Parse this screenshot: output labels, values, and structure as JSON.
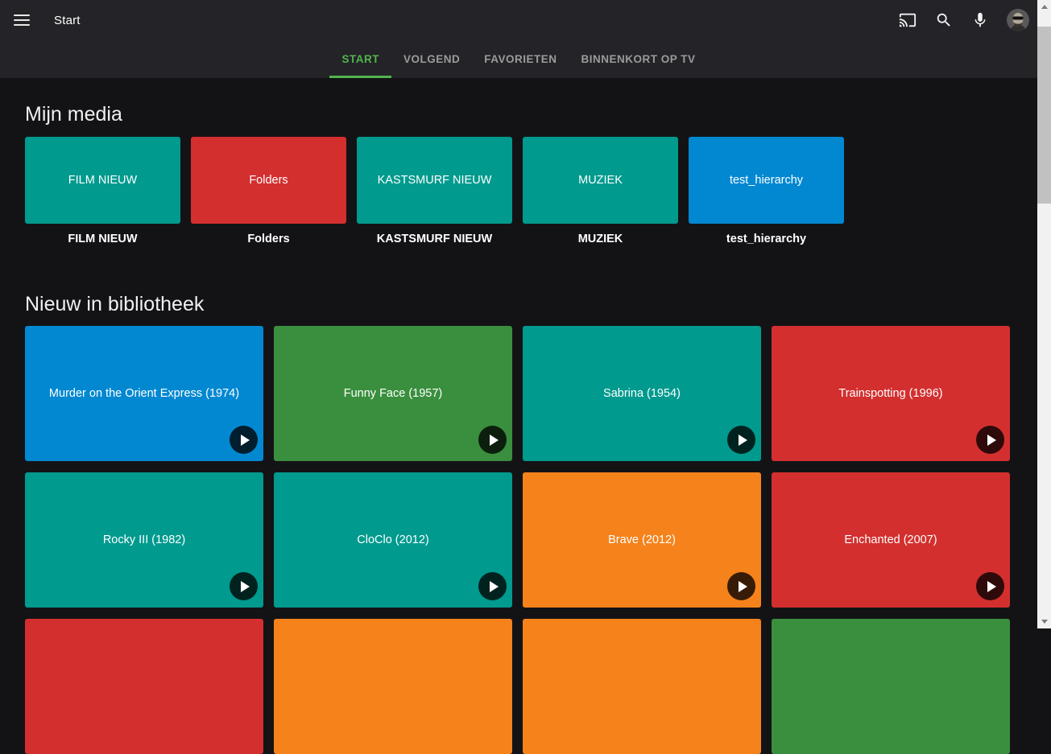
{
  "header": {
    "title": "Start",
    "icons": [
      "menu-icon",
      "cast-icon",
      "search-icon",
      "voice-search-icon",
      "user-avatar"
    ],
    "tabs": [
      {
        "label": "START",
        "active": true
      },
      {
        "label": "VOLGEND",
        "active": false
      },
      {
        "label": "FAVORIETEN",
        "active": false
      },
      {
        "label": "BINNENKORT OP TV",
        "active": false
      }
    ]
  },
  "colors": {
    "accent_green": "#52b54b",
    "header_bg": "#232328",
    "page_bg": "#131316",
    "teal": "#009a8e",
    "red": "#d32f2f",
    "blue": "#0288d1",
    "green": "#3a8f3e",
    "orange": "#f5821b"
  },
  "my_media": {
    "title": "Mijn media",
    "items": [
      {
        "label": "FILM NIEUW",
        "color": "#009a8e"
      },
      {
        "label": "Folders",
        "color": "#d32f2f"
      },
      {
        "label": "KASTSMURF NIEUW",
        "color": "#009a8e"
      },
      {
        "label": "MUZIEK",
        "color": "#009a8e"
      },
      {
        "label": "test_hierarchy",
        "color": "#0288d1"
      }
    ]
  },
  "latest": {
    "title": "Nieuw in bibliotheek",
    "items": [
      {
        "title": "Murder on the Orient Express (1974)",
        "color": "#0288d1"
      },
      {
        "title": "Funny Face (1957)",
        "color": "#3a8f3e"
      },
      {
        "title": "Sabrina (1954)",
        "color": "#009a8e"
      },
      {
        "title": "Trainspotting (1996)",
        "color": "#d32f2f"
      },
      {
        "title": "Rocky III (1982)",
        "color": "#009a8e"
      },
      {
        "title": "CloClo (2012)",
        "color": "#009a8e"
      },
      {
        "title": "Brave (2012)",
        "color": "#f5821b"
      },
      {
        "title": "Enchanted (2007)",
        "color": "#d32f2f"
      }
    ],
    "partial_row": [
      {
        "title": "",
        "color": "#d32f2f"
      },
      {
        "title": "",
        "color": "#f5821b"
      },
      {
        "title": "",
        "color": "#f5821b"
      },
      {
        "title": "",
        "color": "#3a8f3e"
      }
    ]
  }
}
